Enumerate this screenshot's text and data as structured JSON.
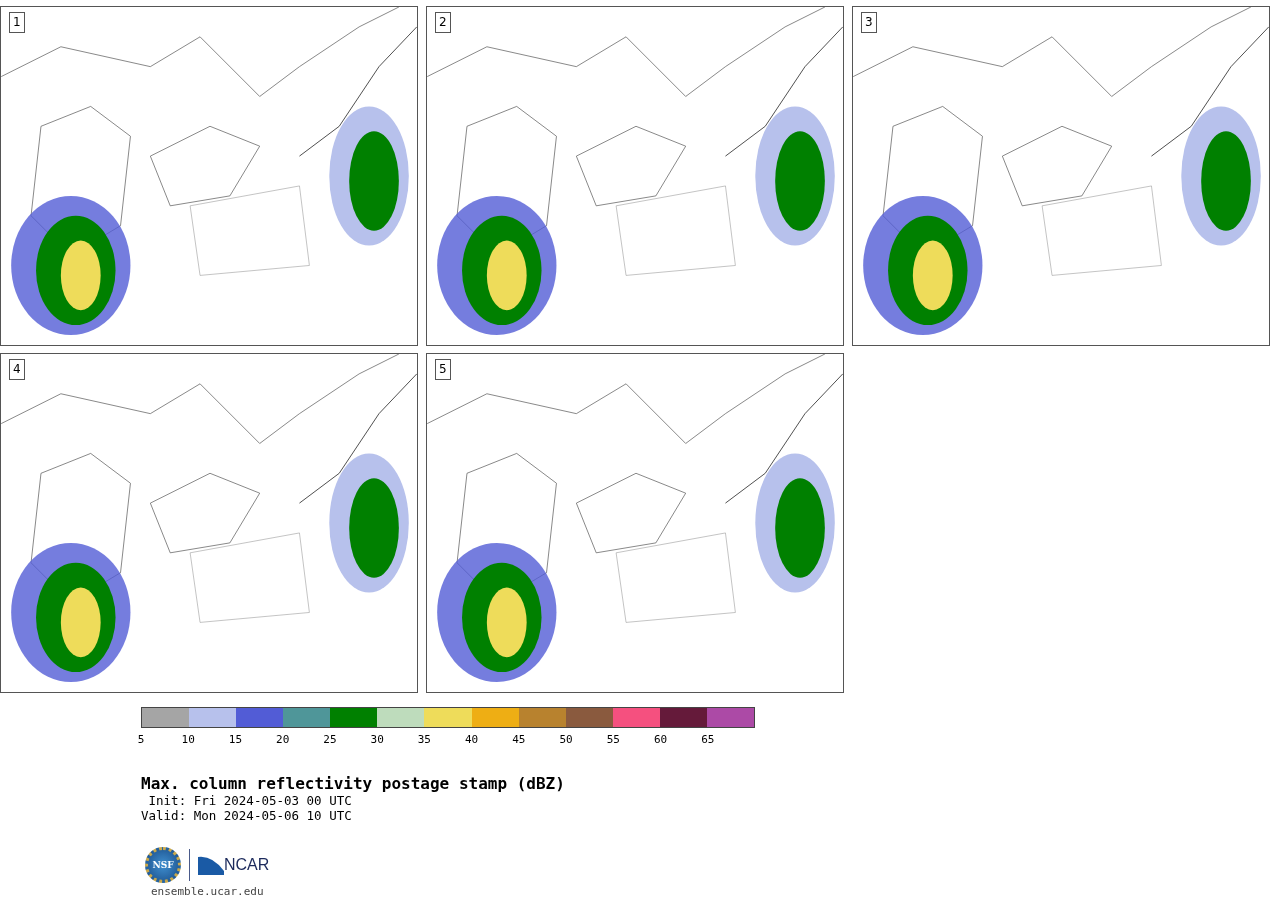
{
  "panels": [
    {
      "label": "1"
    },
    {
      "label": "2"
    },
    {
      "label": "3"
    },
    {
      "label": "4"
    },
    {
      "label": "5"
    }
  ],
  "colorbar": {
    "bins": [
      {
        "color": "#a5a5a5"
      },
      {
        "color": "#b7c1ec"
      },
      {
        "color": "#525cd6"
      },
      {
        "color": "#4f9699"
      },
      {
        "color": "#008000"
      },
      {
        "color": "#bedcbc"
      },
      {
        "color": "#eedc5a"
      },
      {
        "color": "#eeae14"
      },
      {
        "color": "#b8822e"
      },
      {
        "color": "#8a5a3e"
      },
      {
        "color": "#f5507f"
      },
      {
        "color": "#651a3a"
      },
      {
        "color": "#ac4aa6"
      }
    ],
    "ticks": [
      "5",
      "10",
      "15",
      "20",
      "25",
      "30",
      "35",
      "40",
      "45",
      "50",
      "55",
      "60",
      "65"
    ]
  },
  "title": "Max. column reflectivity postage stamp (dBZ)",
  "init": " Init: Fri 2024-05-03 00 UTC",
  "valid": "Valid: Mon 2024-05-06 10 UTC",
  "logos": {
    "nsf": "NSF",
    "ncar": "NCAR"
  },
  "url": "ensemble.ucar.edu"
}
